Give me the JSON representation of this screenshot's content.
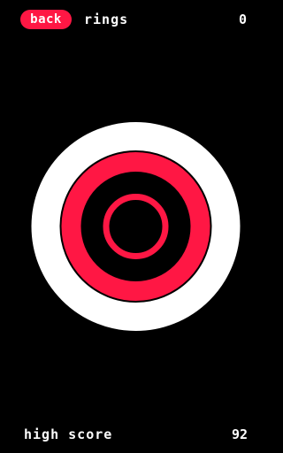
{
  "header": {
    "back_label": "back",
    "title": "rings",
    "score": "0"
  },
  "footer": {
    "high_score_label": "high score",
    "high_score_value": "92"
  },
  "colors": {
    "background": "#000000",
    "accent": "#ff1744",
    "ring_white": "#ffffff"
  },
  "rings": [
    {
      "name": "outer-ring",
      "color": "#ffffff"
    },
    {
      "name": "middle-ring",
      "color": "#ff1744"
    },
    {
      "name": "inner-ring",
      "color": "#ff1744"
    }
  ]
}
